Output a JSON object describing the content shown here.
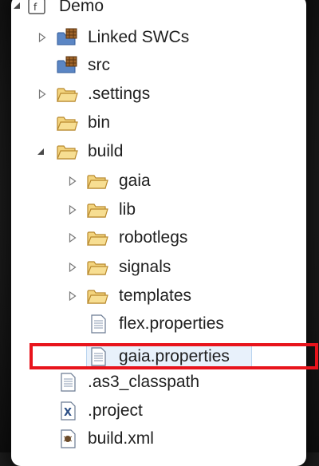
{
  "tree": {
    "root": {
      "label": "Demo",
      "icon": "flex-project-icon"
    },
    "items": [
      {
        "label": "Linked SWCs",
        "icon": "library-folder-icon",
        "twisty": "collapsed"
      },
      {
        "label": "src",
        "icon": "source-folder-icon",
        "twisty": "none"
      },
      {
        "label": ".settings",
        "icon": "folder-icon",
        "twisty": "collapsed"
      },
      {
        "label": "bin",
        "icon": "folder-icon",
        "twisty": "none"
      },
      {
        "label": "build",
        "icon": "folder-open-icon",
        "twisty": "expanded"
      },
      {
        "label": "gaia",
        "icon": "folder-icon",
        "twisty": "collapsed"
      },
      {
        "label": "lib",
        "icon": "folder-icon",
        "twisty": "collapsed"
      },
      {
        "label": "robotlegs",
        "icon": "folder-icon",
        "twisty": "collapsed"
      },
      {
        "label": "signals",
        "icon": "folder-icon",
        "twisty": "collapsed"
      },
      {
        "label": "templates",
        "icon": "folder-icon",
        "twisty": "collapsed"
      },
      {
        "label": "flex.properties",
        "icon": "properties-file-icon",
        "twisty": "none"
      },
      {
        "label": "gaia.properties",
        "icon": "properties-file-icon",
        "twisty": "none",
        "selected": true,
        "annotated": true
      },
      {
        "label": ".as3_classpath",
        "icon": "text-file-icon",
        "twisty": "none"
      },
      {
        "label": ".project",
        "icon": "xml-file-icon",
        "twisty": "none"
      },
      {
        "label": "build.xml",
        "icon": "ant-file-icon",
        "twisty": "none"
      }
    ]
  },
  "colors": {
    "annotation": "#e8141c",
    "folder": "#e9c464",
    "selection": "#e8f1fb"
  }
}
